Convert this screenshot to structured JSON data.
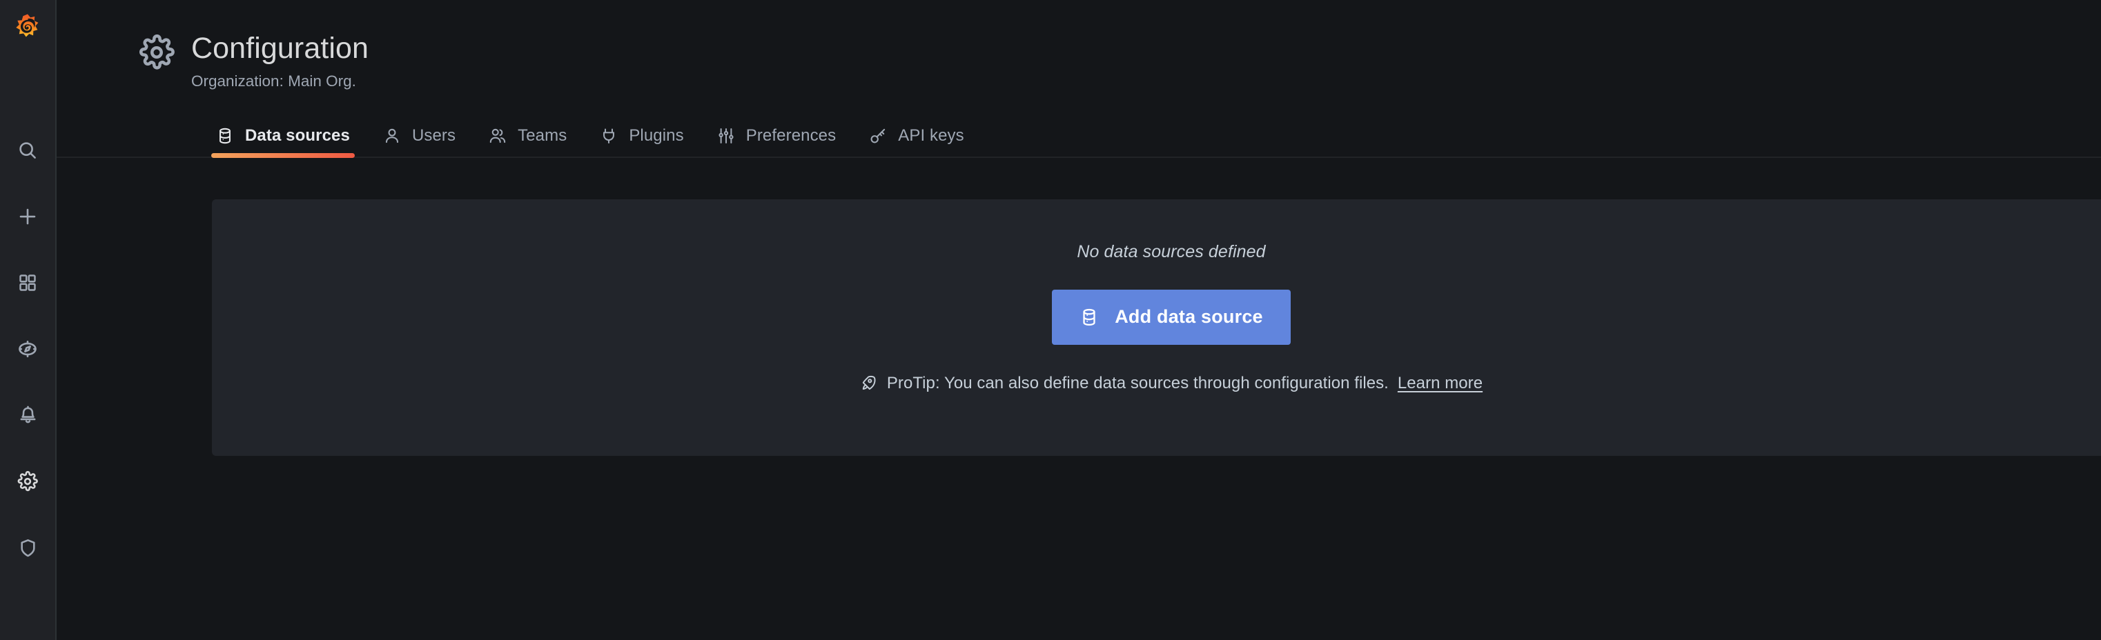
{
  "sidebar": {
    "brand": {
      "name": "grafana-logo",
      "label": "Grafana"
    },
    "items": [
      {
        "icon": "search-icon",
        "label": "Search",
        "active": false
      },
      {
        "icon": "plus-icon",
        "label": "Create",
        "active": false
      },
      {
        "icon": "apps-icon",
        "label": "Dashboards",
        "active": false
      },
      {
        "icon": "compass-icon",
        "label": "Explore",
        "active": false
      },
      {
        "icon": "bell-icon",
        "label": "Alerting",
        "active": false
      },
      {
        "icon": "gear-icon",
        "label": "Configuration",
        "active": true
      },
      {
        "icon": "shield-icon",
        "label": "Server Admin",
        "active": false
      }
    ]
  },
  "header": {
    "icon": "gear-icon",
    "title": "Configuration",
    "subtitle": "Organization: Main Org."
  },
  "tabs": [
    {
      "label": "Data sources",
      "icon": "database-icon",
      "active": true
    },
    {
      "label": "Users",
      "icon": "user-icon",
      "active": false
    },
    {
      "label": "Teams",
      "icon": "users-icon",
      "active": false
    },
    {
      "label": "Plugins",
      "icon": "plug-icon",
      "active": false
    },
    {
      "label": "Preferences",
      "icon": "sliders-icon",
      "active": false
    },
    {
      "label": "API keys",
      "icon": "key-icon",
      "active": false
    }
  ],
  "main": {
    "empty_message": "No data sources defined",
    "add_button": {
      "label": "Add data source",
      "icon": "database-icon"
    },
    "protip": {
      "icon": "rocket-icon",
      "text": "ProTip: You can also define data sources through configuration files.",
      "link_label": "Learn more"
    }
  },
  "colors": {
    "page_background": "#141619",
    "sidebar_background": "#202226",
    "panel_background": "#22252b",
    "accent_primary": "#6185dd",
    "tab_active_gradient_start": "#f2a35c",
    "tab_active_gradient_end": "#f05a43",
    "text_primary": "#d8d9da",
    "text_secondary": "#9fa7b3"
  }
}
